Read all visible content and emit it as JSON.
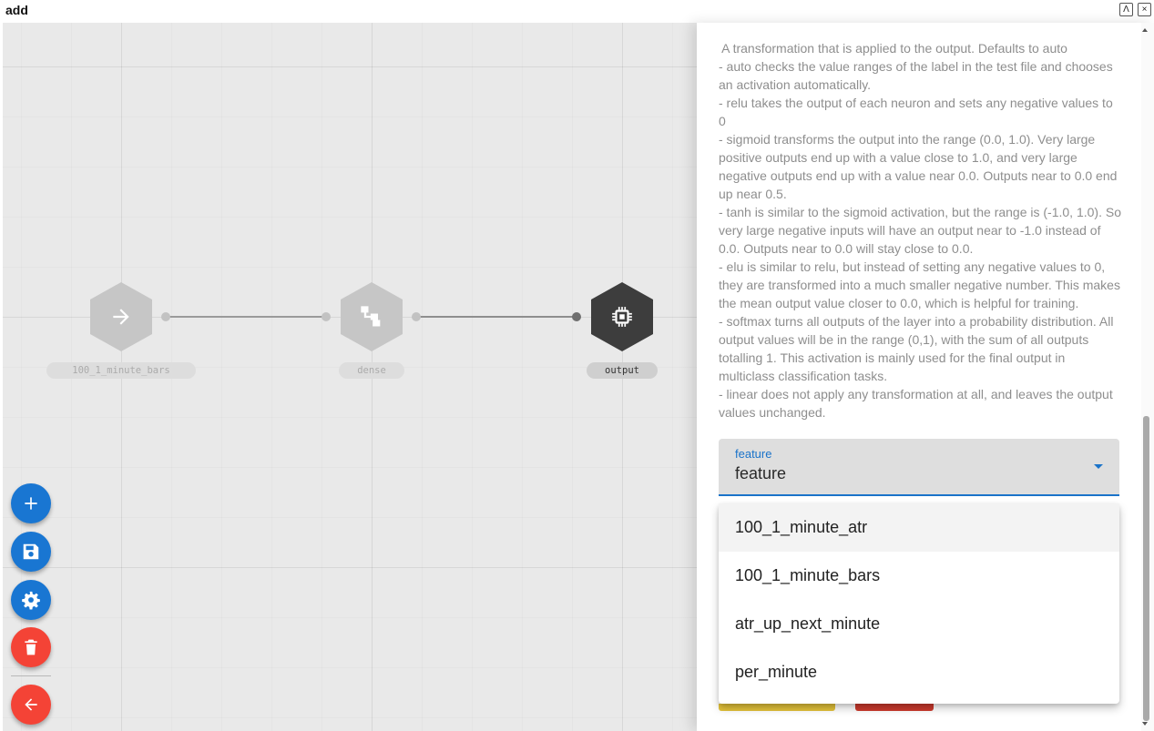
{
  "window": {
    "title": "add",
    "maximize_symbol": "Λ",
    "close_symbol": "×"
  },
  "canvas": {
    "nodes": [
      {
        "label": "100_1_minute_bars",
        "icon": "arrow-right-icon",
        "state": "dimmed"
      },
      {
        "label": "dense",
        "icon": "hierarchy-icon",
        "state": "dimmed"
      },
      {
        "label": "output",
        "icon": "chip-icon",
        "state": "selected"
      }
    ],
    "colors": {
      "dimmed_node": "#c6c6c6",
      "selected_node": "#3d3d3d",
      "fab_blue": "#1976d2",
      "fab_red": "#f44336"
    }
  },
  "fabs": [
    {
      "name": "add-button",
      "icon": "plus-icon"
    },
    {
      "name": "save-button",
      "icon": "save-icon"
    },
    {
      "name": "settings-button",
      "icon": "gear-icon"
    },
    {
      "name": "delete-button",
      "icon": "trash-icon"
    },
    {
      "name": "back-button",
      "icon": "arrow-left-icon"
    }
  ],
  "panel": {
    "help_lines": [
      " A transformation that is applied to the output. Defaults to auto",
      "- auto checks the value ranges of the label in the test file and chooses an activation automatically.",
      "- relu takes the output of each neuron and sets any negative values to 0",
      "- sigmoid transforms the output into the range (0.0, 1.0). Very large positive outputs end up with a value close to 1.0, and very large negative outputs end up with a value near 0.0. Outputs near to 0.0 end up near 0.5.",
      "- tanh is similar to the sigmoid activation, but the range is (-1.0, 1.0). So very large negative inputs will have an output near to -1.0 instead of 0.0. Outputs near to 0.0 will stay close to 0.0.",
      "- elu is similar to relu, but instead of setting any negative values to 0, they are transformed into a much smaller negative number. This makes the mean output value closer to 0.0, which is helpful for training.",
      "- softmax turns all outputs of the layer into a probability distribution. All output values will be in the range (0,1), with the sum of all outputs totalling 1. This activation is mainly used for the final output in multiclass classification tasks.",
      "- linear does not apply any transformation at all, and leaves the output values unchanged."
    ],
    "feature_select": {
      "label": "feature",
      "value": "feature",
      "options": [
        "100_1_minute_atr",
        "100_1_minute_bars",
        "atr_up_next_minute",
        "per_minute"
      ]
    }
  }
}
